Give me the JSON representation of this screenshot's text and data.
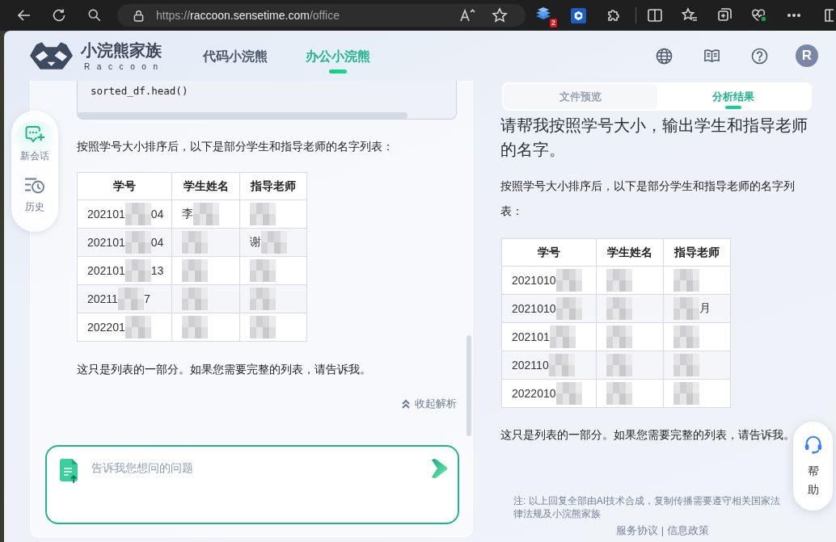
{
  "browser": {
    "url_scheme": "https://",
    "url_host": "raccoon.sensetime.com",
    "url_path": "/office",
    "extension_badge": "2"
  },
  "header": {
    "brand": "小浣熊家族",
    "brand_sub": "Raccoon",
    "nav": [
      {
        "label": "代码小浣熊",
        "selected": false
      },
      {
        "label": "办公小浣熊",
        "selected": true
      }
    ],
    "avatar": "R"
  },
  "sidebar": {
    "items": [
      {
        "kind": "new_chat",
        "label": "新会话"
      },
      {
        "kind": "history",
        "label": "历史"
      }
    ]
  },
  "chat": {
    "code": "sorted_df.head()",
    "intro": "按照学号大小排序后，以下是部分学生和指导老师的名字列表：",
    "table": {
      "columns": [
        "学号",
        "学生姓名",
        "指导老师"
      ],
      "rows": [
        [
          {
            "text": "202101",
            "redacted": true,
            "tail": "04"
          },
          {
            "text": "李",
            "redacted": true
          },
          {
            "redacted": true
          }
        ],
        [
          {
            "text": "202101",
            "redacted": true,
            "tail": "04"
          },
          {
            "redacted": true
          },
          {
            "text": "谢",
            "redacted": true
          }
        ],
        [
          {
            "text": "202101",
            "redacted": true,
            "tail": "13"
          },
          {
            "redacted": true
          },
          {
            "redacted": true
          }
        ],
        [
          {
            "text": "20211",
            "redacted": true,
            "tail": "7"
          },
          {
            "redacted": true
          },
          {
            "redacted": true
          }
        ],
        [
          {
            "text": "202201",
            "redacted": true
          },
          {
            "redacted": true
          },
          {
            "redacted": true
          }
        ]
      ]
    },
    "outro": "这只是列表的一部分。如果您需要完整的列表，请告诉我。",
    "collapse": "收起解析",
    "input": {
      "placeholder": "告诉我您想问的问题"
    }
  },
  "results": {
    "tabs": [
      {
        "label": "文件预览",
        "selected": false
      },
      {
        "label": "分析结果",
        "selected": true
      }
    ],
    "question": "请帮我按照学号大小，输出学生和指导老师的名字。",
    "intro": "按照学号大小排序后，以下是部分学生和指导老师的名字列表：",
    "table": {
      "columns": [
        "学号",
        "学生姓名",
        "指导老师"
      ],
      "rows": [
        [
          {
            "text": "2021010",
            "redacted": true
          },
          {
            "redacted": true
          },
          {
            "redacted": true
          }
        ],
        [
          {
            "text": "2021010",
            "redacted": true
          },
          {
            "redacted": true
          },
          {
            "redacted": true,
            "tail": "月"
          }
        ],
        [
          {
            "text": "202101",
            "redacted": true
          },
          {
            "redacted": true
          },
          {
            "redacted": true
          }
        ],
        [
          {
            "text": "202110",
            "redacted": true
          },
          {
            "redacted": true
          },
          {
            "redacted": true
          }
        ],
        [
          {
            "text": "2022010",
            "redacted": true
          },
          {
            "redacted": true
          },
          {
            "redacted": true
          }
        ]
      ]
    },
    "outro": "这只是列表的一部分。如果您需要完整的列表，请告诉我。",
    "note": "注: 以上回复全部由AI技术合成，复制传播需要遵守相关国家法律法规及小浣熊家族",
    "footer": {
      "links": [
        "服务协议",
        "信息政策"
      ],
      "separator": "|"
    }
  },
  "help": {
    "label": "帮助"
  }
}
